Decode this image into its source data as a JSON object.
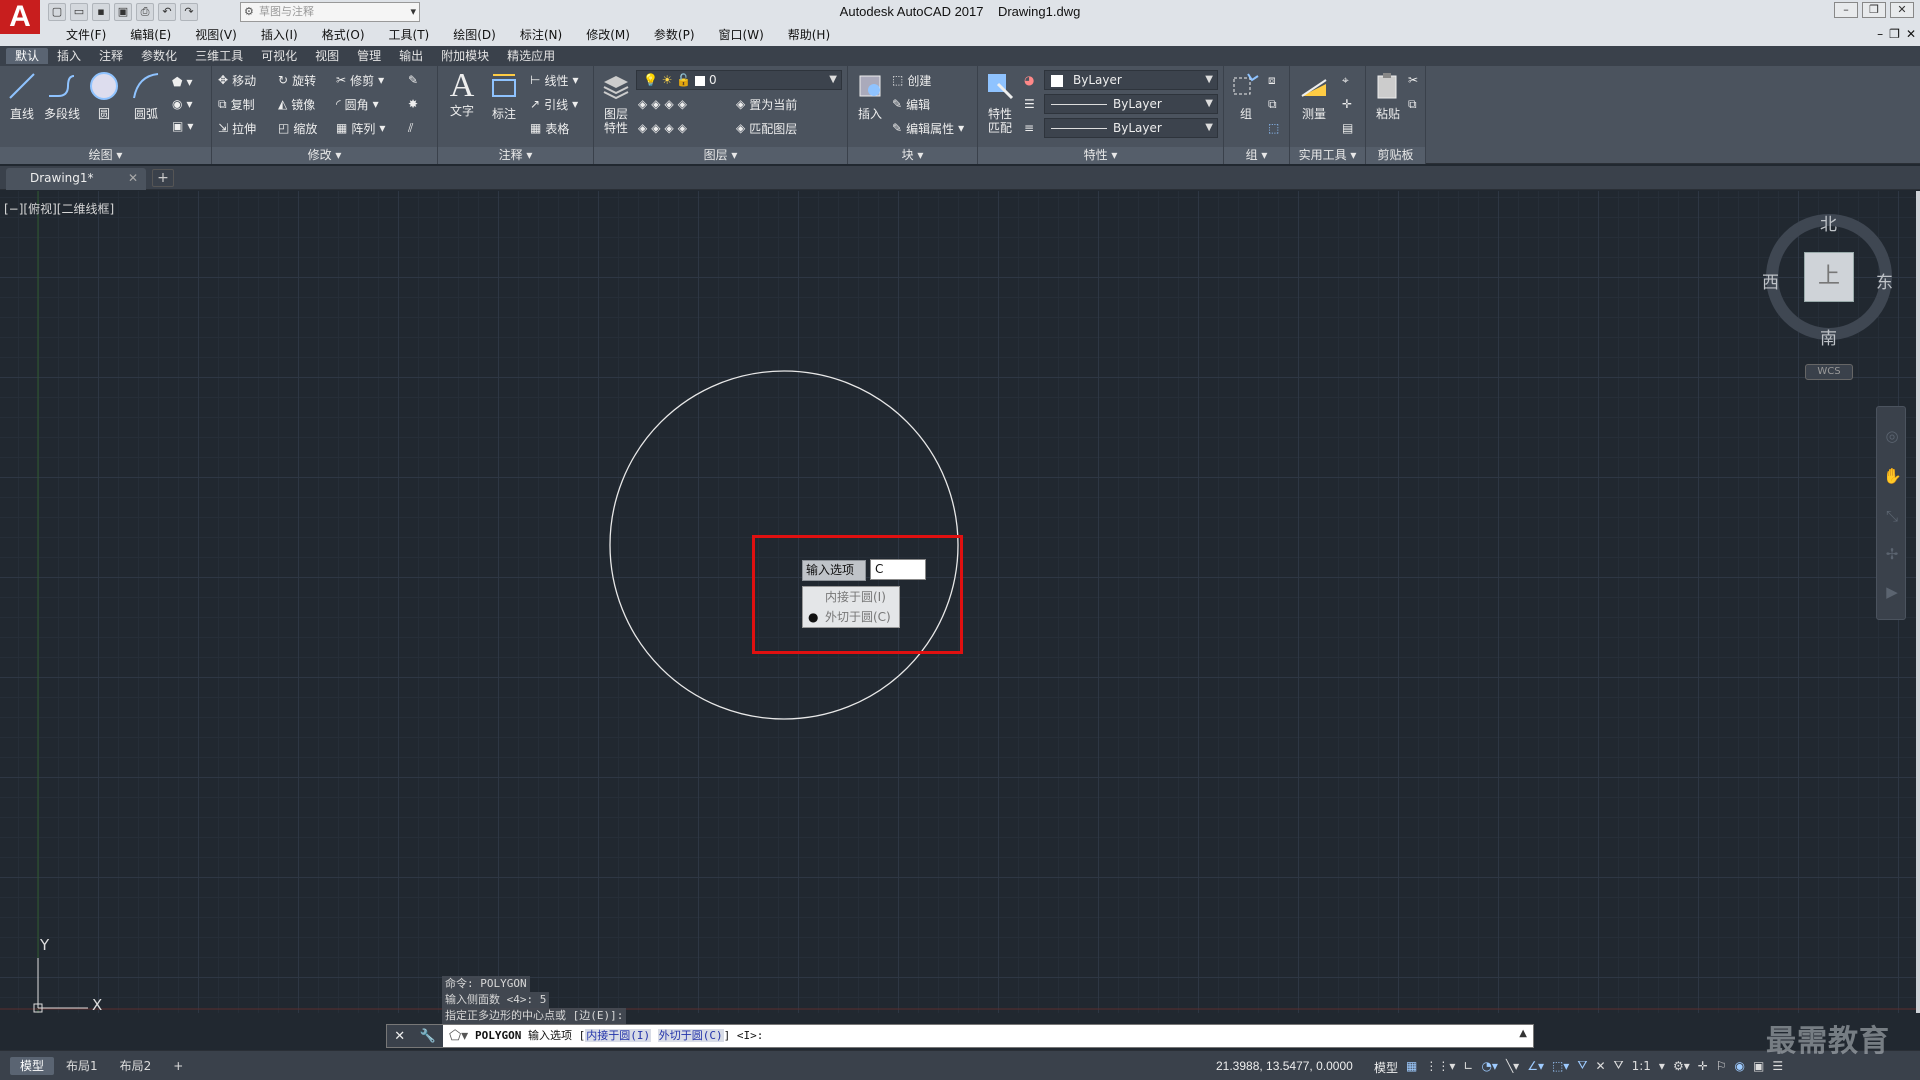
{
  "window": {
    "app_title": "Autodesk AutoCAD 2017",
    "file_title": "Drawing1.dwg",
    "logo": "A",
    "workspace_placeholder": "草图与注释"
  },
  "menu": [
    "文件(F)",
    "编辑(E)",
    "视图(V)",
    "插入(I)",
    "格式(O)",
    "工具(T)",
    "绘图(D)",
    "标注(N)",
    "修改(M)",
    "参数(P)",
    "窗口(W)",
    "帮助(H)"
  ],
  "ribbon_tabs": [
    "默认",
    "插入",
    "注释",
    "参数化",
    "三维工具",
    "可视化",
    "视图",
    "管理",
    "输出",
    "附加模块",
    "精选应用"
  ],
  "ribbon": {
    "draw": {
      "title": "绘图",
      "line": "直线",
      "polyline": "多段线",
      "circle": "圆",
      "arc": "圆弧"
    },
    "modify": {
      "title": "修改",
      "move": "移动",
      "rotate": "旋转",
      "trim": "修剪",
      "copy": "复制",
      "mirror": "镜像",
      "fillet": "圆角",
      "stretch": "拉伸",
      "scale": "缩放",
      "array": "阵列"
    },
    "annotation": {
      "title": "注释",
      "text": "文字",
      "dimension": "标注",
      "linear": "线性",
      "leader": "引线",
      "table": "表格"
    },
    "layers": {
      "title": "图层",
      "layer_props": "图层\n特性",
      "layer_props_1": "图层",
      "layer_props_2": "特性",
      "current_layer": "0",
      "make_current": "置为当前",
      "match_layer": "匹配图层"
    },
    "block": {
      "title": "块",
      "insert": "插入",
      "create": "创建",
      "edit": "编辑",
      "edit_attr": "编辑属性"
    },
    "properties": {
      "title": "特性",
      "match_1": "特性",
      "match_2": "匹配",
      "color": "ByLayer",
      "linetype": "ByLayer",
      "lineweight": "ByLayer"
    },
    "groups": {
      "title": "组",
      "group": "组"
    },
    "utilities": {
      "title": "实用工具",
      "measure": "测量"
    },
    "clipboard": {
      "title": "剪贴板",
      "paste": "粘贴"
    }
  },
  "file_tab": {
    "label": "Drawing1*"
  },
  "viewport_label": "[−][俯视][二维线框]",
  "viewcube": {
    "north": "北",
    "south": "南",
    "east": "东",
    "west": "西",
    "face": "上",
    "wcs": "WCS"
  },
  "dynamic_prompt": {
    "label": "输入选项",
    "value": "C",
    "options": [
      {
        "label": "内接于圆(I)",
        "selected": false
      },
      {
        "label": "外切于圆(C)",
        "selected": true
      }
    ]
  },
  "ucs": {
    "x": "X",
    "y": "Y"
  },
  "command_history": [
    "命令: POLYGON",
    "输入侧面数 <4>: 5",
    "指定正多边形的中心点或 [边(E)]:"
  ],
  "command_line": {
    "cmd": "POLYGON",
    "prefix": " 输入选项 [",
    "opt1": "内接于圆(I)",
    "sep": " ",
    "opt2": "外切于圆(C)",
    "suffix": "] <I>:"
  },
  "status": {
    "layouts": [
      "模型",
      "布局1",
      "布局2"
    ],
    "coords": "21.3988, 13.5477, 0.0000",
    "model": "模型",
    "scale": "1:1"
  },
  "watermark": "最需教育"
}
